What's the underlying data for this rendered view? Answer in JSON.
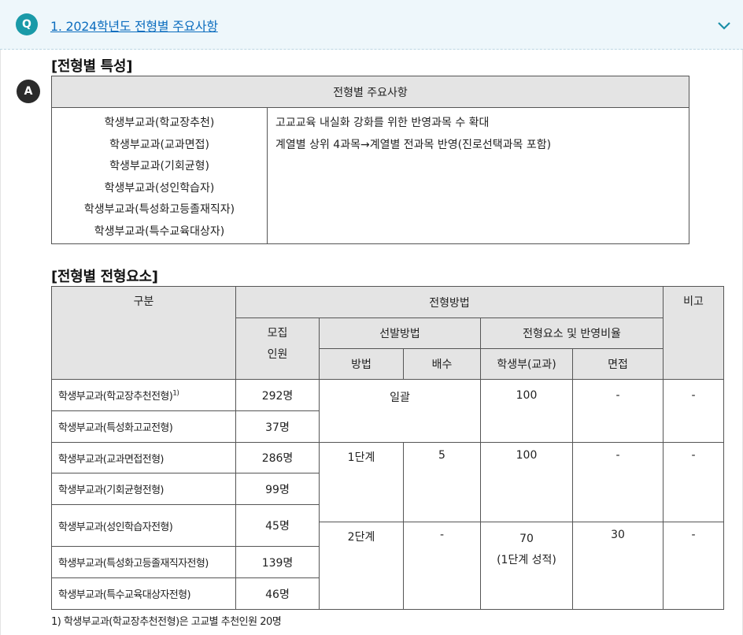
{
  "question": {
    "badge": "Q",
    "title": "1. 2024학년도 전형별 주요사항"
  },
  "answer": {
    "badge": "A"
  },
  "section1": {
    "title": "[전형별 특성]",
    "header": "전형별 주요사항",
    "left_items": [
      "학생부교과(학교장추천)",
      "학생부교과(교과면접)",
      "학생부교과(기회균형)",
      "학생부교과(성인학습자)",
      "학생부교과(특성화고등졸재직자)",
      "학생부교과(특수교육대상자)"
    ],
    "right_items": [
      "고교교육 내실화 강화를 위한 반영과목 수 확대",
      "계열별 상위 4과목→계열별 전과목 반영(진로선택과목 포함)"
    ]
  },
  "section2": {
    "title": "[전형별 전형요소]",
    "headers": {
      "category": "구분",
      "method": "전형방법",
      "note": "비고",
      "recruit_1": "모집",
      "recruit_2": "인원",
      "selection": "선발방법",
      "elements": "전형요소 및 반영비율",
      "sel_method": "방법",
      "multiple": "배수",
      "record": "학생부(교과)",
      "interview": "면접"
    },
    "rows": [
      {
        "name": "학생부교과(학교장추천전형)",
        "sup": "1)",
        "count": "292명"
      },
      {
        "name": "학생부교과(특성화고교전형)",
        "count": "37명"
      },
      {
        "name": "학생부교과(교과면접전형)",
        "count": "286명"
      },
      {
        "name": "학생부교과(기회균형전형)",
        "count": "99명"
      },
      {
        "name": "학생부교과(성인학습자전형)",
        "count": "45명"
      },
      {
        "name": "학생부교과(특성화고등졸재직자전형)",
        "count": "139명"
      },
      {
        "name": "학생부교과(특수교육대상자전형)",
        "count": "46명"
      }
    ],
    "group1": {
      "method": "일괄",
      "record": "100",
      "interview": "-",
      "note": "-"
    },
    "group2": {
      "method": "1단계",
      "multiple": "5",
      "record": "100",
      "interview": "-",
      "note": "-"
    },
    "group3": {
      "method": "2단계",
      "multiple": "-",
      "record": "70",
      "record_sub": "(1단계 성적)",
      "interview": "30",
      "note": "-"
    }
  },
  "footnote": "1) 학생부교과(학교장추천전형)은 고교별 추천인원 20명"
}
